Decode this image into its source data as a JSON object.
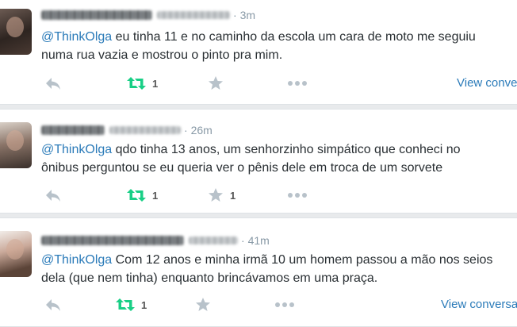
{
  "tweets": [
    {
      "time": "3m",
      "mention": "@ThinkOlga",
      "line1": " eu tinha 11 e no caminho da escola um cara de moto me seguiu",
      "line2": "numa rua vazia e mostrou o pinto pra mim.",
      "retweets": "1",
      "favorites": "",
      "view_conversation": "View conversation"
    },
    {
      "time": "26m",
      "mention": "@ThinkOlga",
      "line1": " qdo tinha 13 anos, um senhorzinho simpático que conheci no",
      "line2": "ônibus perguntou se eu queria ver o pênis dele em troca de um sorvete",
      "retweets": "1",
      "favorites": "1",
      "view_conversation": ""
    },
    {
      "time": "41m",
      "mention": "@ThinkOlga",
      "line1": " Com 12 anos e minha irmã 10 um homem passou a mão nos seios",
      "line2": "dela (que nem tinha) enquanto brincávamos em uma praça.",
      "retweets": "1",
      "favorites": "",
      "view_conversation": "View conversation"
    }
  ],
  "colors": {
    "link": "#2b7bb9",
    "text": "#292f33",
    "meta": "#8899a6",
    "retweet": "#19cf86",
    "icon": "#b8c2ca"
  },
  "icons": [
    "reply-icon",
    "retweet-icon",
    "favorite-icon",
    "more-icon"
  ]
}
